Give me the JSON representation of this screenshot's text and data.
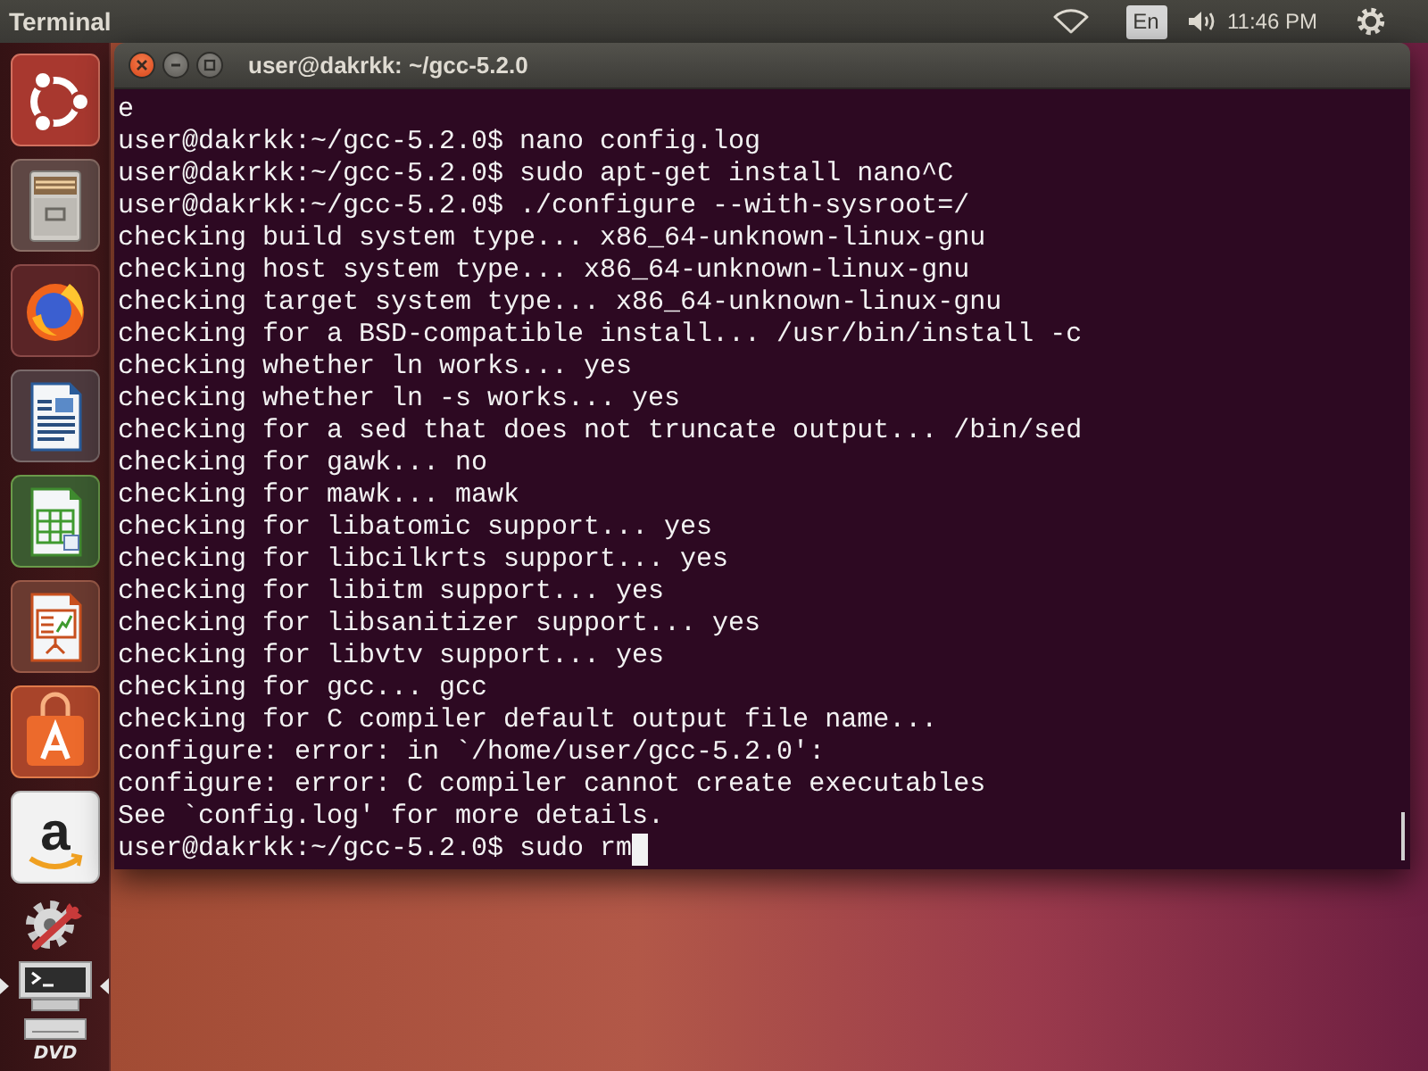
{
  "top_panel": {
    "app_name": "Terminal",
    "keyboard_layout": "En",
    "clock": "11:46 PM"
  },
  "launcher": {
    "items": [
      {
        "kind": "dash",
        "running": false,
        "focused": false
      },
      {
        "kind": "files",
        "running": false,
        "focused": false
      },
      {
        "kind": "browser",
        "running": false,
        "focused": false
      },
      {
        "kind": "writer",
        "running": false,
        "focused": false
      },
      {
        "kind": "calc",
        "running": false,
        "focused": false
      },
      {
        "kind": "impress",
        "running": false,
        "focused": false
      },
      {
        "kind": "store",
        "running": false,
        "focused": false
      },
      {
        "kind": "amazon",
        "glyph": "a",
        "running": false,
        "focused": false
      },
      {
        "kind": "settings",
        "running": false,
        "focused": false
      },
      {
        "kind": "terminal",
        "running": true,
        "focused": true
      },
      {
        "kind": "dvd",
        "glyph": "DVD",
        "running": false,
        "focused": false
      }
    ]
  },
  "window": {
    "title": "user@dakrkk: ~/gcc-5.2.0"
  },
  "terminal": {
    "lines": [
      "e",
      "user@dakrkk:~/gcc-5.2.0$ nano config.log",
      "user@dakrkk:~/gcc-5.2.0$ sudo apt-get install nano^C",
      "user@dakrkk:~/gcc-5.2.0$ ./configure --with-sysroot=/",
      "checking build system type... x86_64-unknown-linux-gnu",
      "checking host system type... x86_64-unknown-linux-gnu",
      "checking target system type... x86_64-unknown-linux-gnu",
      "checking for a BSD-compatible install... /usr/bin/install -c",
      "checking whether ln works... yes",
      "checking whether ln -s works... yes",
      "checking for a sed that does not truncate output... /bin/sed",
      "checking for gawk... no",
      "checking for mawk... mawk",
      "checking for libatomic support... yes",
      "checking for libcilkrts support... yes",
      "checking for libitm support... yes",
      "checking for libsanitizer support... yes",
      "checking for libvtv support... yes",
      "checking for gcc... gcc",
      "checking for C compiler default output file name...",
      "configure: error: in `/home/user/gcc-5.2.0':",
      "configure: error: C compiler cannot create executables",
      "See `config.log' for more details.",
      "user@dakrkk:~/gcc-5.2.0$ sudo rm"
    ],
    "cursor": true
  }
}
